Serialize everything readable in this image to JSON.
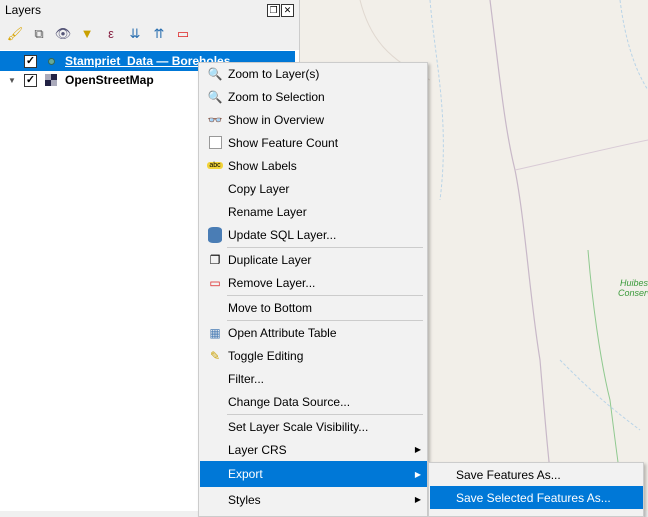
{
  "panel": {
    "title": "Layers"
  },
  "layers": [
    {
      "name": "Stampriet_Data — Boreholes",
      "checked": true,
      "selected": true
    },
    {
      "name": "OpenStreetMap",
      "checked": true,
      "selected": false
    }
  ],
  "map": {
    "label_line1": "Huibes",
    "label_line2": "Conservancy"
  },
  "menu": {
    "items": [
      {
        "label": "Zoom to Layer(s)",
        "icon": "zoom-layer-icon"
      },
      {
        "label": "Zoom to Selection",
        "icon": "zoom-selection-icon"
      },
      {
        "label": "Show in Overview",
        "icon": "overview-icon"
      },
      {
        "label": "Show Feature Count",
        "icon": "checkbox-icon"
      },
      {
        "label": "Show Labels",
        "icon": "labels-icon"
      },
      {
        "label": "Copy Layer"
      },
      {
        "label": "Rename Layer"
      },
      {
        "label": "Update SQL Layer...",
        "icon": "database-icon"
      },
      {
        "label": "Duplicate Layer",
        "icon": "duplicate-icon"
      },
      {
        "label": "Remove Layer...",
        "icon": "remove-icon"
      },
      {
        "label": "Move to Bottom"
      },
      {
        "label": "Open Attribute Table",
        "icon": "table-icon"
      },
      {
        "label": "Toggle Editing",
        "icon": "pencil-icon"
      },
      {
        "label": "Filter..."
      },
      {
        "label": "Change Data Source..."
      },
      {
        "label": "Set Layer Scale Visibility..."
      },
      {
        "label": "Layer CRS"
      },
      {
        "label": "Export"
      },
      {
        "label": "Styles"
      }
    ]
  },
  "submenu": {
    "items": [
      "Save Features As...",
      "Save Selected Features As..."
    ]
  },
  "colors": {
    "highlight": "#0078d7",
    "map_bg": "#f2efe9"
  }
}
